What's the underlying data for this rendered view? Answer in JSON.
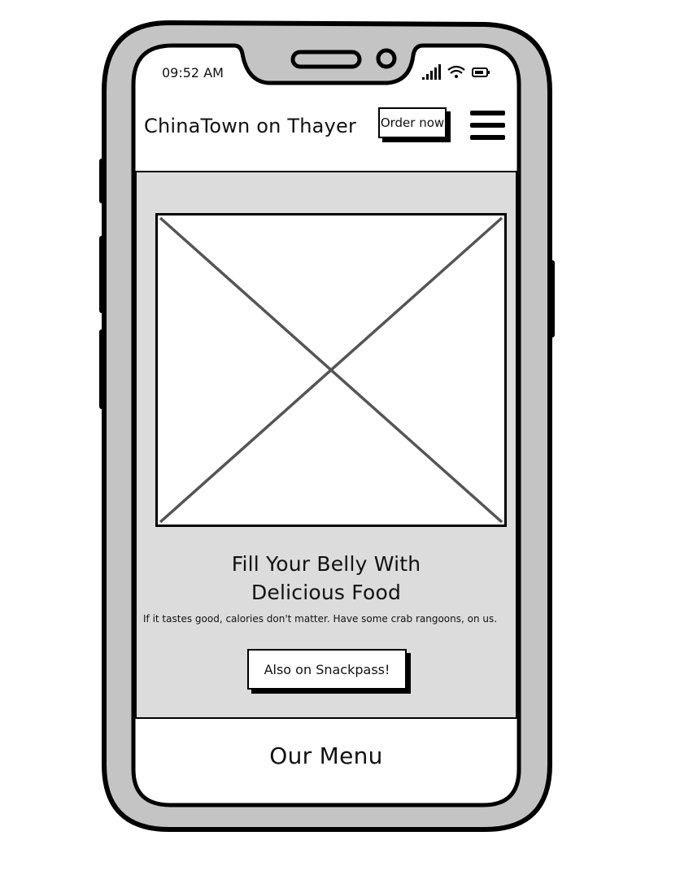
{
  "status_bar": {
    "time": "09:52 AM",
    "icons": [
      "signal-icon",
      "wifi-icon",
      "battery-icon"
    ]
  },
  "header": {
    "title": "ChinaTown on Thayer",
    "order_label": "Order now",
    "menu_icon": "hamburger-menu-icon"
  },
  "hero": {
    "image_icon": "image-placeholder-icon",
    "title_line1": "Fill Your Belly With",
    "title_line2": "Delicious Food",
    "subtitle": "If it tastes good, calories don't matter. Have some crab rangoons, on us.",
    "cta_label": "Also on Snackpass!"
  },
  "menu_section": {
    "heading": "Our Menu"
  },
  "colors": {
    "frame": "#c4c4c4",
    "hero_bg": "#dcdcdc",
    "ink": "#000000",
    "placeholder_x": "#555555"
  }
}
